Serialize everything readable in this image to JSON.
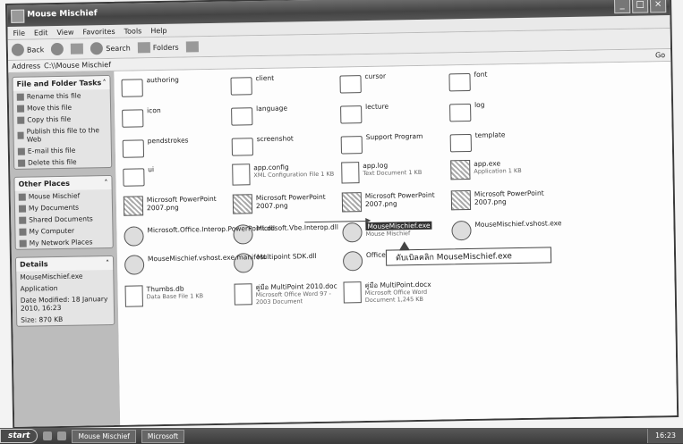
{
  "window": {
    "title": "Mouse Mischief"
  },
  "menu": [
    "File",
    "Edit",
    "View",
    "Favorites",
    "Tools",
    "Help"
  ],
  "toolbar": {
    "back": "Back",
    "search": "Search",
    "folders": "Folders"
  },
  "address": {
    "label": "Address",
    "path": "C:\\\\Mouse Mischief",
    "go": "Go"
  },
  "taskpane": {
    "file_tasks": {
      "title": "File and Folder Tasks",
      "items": [
        "Rename this file",
        "Move this file",
        "Copy this file",
        "Publish this file to the Web",
        "E-mail this file",
        "Delete this file"
      ]
    },
    "other_places": {
      "title": "Other Places",
      "items": [
        "Mouse Mischief",
        "My Documents",
        "Shared Documents",
        "My Computer",
        "My Network Places"
      ]
    },
    "details": {
      "title": "Details",
      "lines": [
        "MouseMischief.exe",
        "Application",
        "Date Modified: 18 January 2010, 16:23",
        "Size: 870 KB"
      ]
    }
  },
  "files": [
    {
      "name": "authoring",
      "sub": "",
      "type": "folder"
    },
    {
      "name": "client",
      "sub": "",
      "type": "folder"
    },
    {
      "name": "cursor",
      "sub": "",
      "type": "folder"
    },
    {
      "name": "font",
      "sub": "",
      "type": "folder"
    },
    {
      "name": "icon",
      "sub": "",
      "type": "folder"
    },
    {
      "name": "language",
      "sub": "",
      "type": "folder"
    },
    {
      "name": "lecture",
      "sub": "",
      "type": "folder"
    },
    {
      "name": "log",
      "sub": "",
      "type": "folder"
    },
    {
      "name": "pendstrokes",
      "sub": "",
      "type": "folder"
    },
    {
      "name": "screenshot",
      "sub": "",
      "type": "folder"
    },
    {
      "name": "Support Program",
      "sub": "",
      "type": "folder"
    },
    {
      "name": "template",
      "sub": "",
      "type": "folder"
    },
    {
      "name": "ui",
      "sub": "",
      "type": "folder"
    },
    {
      "name": "app.config",
      "sub": "XML Configuration File 1 KB",
      "type": "doc"
    },
    {
      "name": "app.log",
      "sub": "Text Document 1 KB",
      "type": "doc"
    },
    {
      "name": "app.exe",
      "sub": "Application 1 KB",
      "type": "img"
    },
    {
      "name": "Microsoft PowerPoint 2007.png",
      "sub": "",
      "type": "img"
    },
    {
      "name": "Microsoft PowerPoint 2007.png",
      "sub": "",
      "type": "img"
    },
    {
      "name": "Microsoft PowerPoint 2007.png",
      "sub": "",
      "type": "img"
    },
    {
      "name": "Microsoft PowerPoint 2007.png",
      "sub": "",
      "type": "img"
    },
    {
      "name": "Microsoft.Office.Interop.PowerPoint.dll",
      "sub": "",
      "type": "app"
    },
    {
      "name": "Microsoft.Vbe.Interop.dll",
      "sub": "",
      "type": "app"
    },
    {
      "name": "MouseMischief.exe",
      "sub": "Mouse Mischief",
      "type": "app",
      "selected": true
    },
    {
      "name": "MouseMischief.vshost.exe",
      "sub": "",
      "type": "app"
    },
    {
      "name": "MouseMischief.vshost.exe.manifest",
      "sub": "",
      "type": "app"
    },
    {
      "name": "Multipoint SDK.dll",
      "sub": "",
      "type": "app"
    },
    {
      "name": "Office.dll",
      "sub": "",
      "type": "app"
    },
    {
      "name": "",
      "sub": "",
      "type": "none"
    },
    {
      "name": "Thumbs.db",
      "sub": "Data Base File 1 KB",
      "type": "doc"
    },
    {
      "name": "คู่มือ MultiPoint 2010.doc",
      "sub": "Microsoft Office Word 97 - 2003 Document",
      "type": "doc"
    },
    {
      "name": "คู่มือ MultiPoint.docx",
      "sub": "Microsoft Office Word Document 1,245 KB",
      "type": "doc"
    }
  ],
  "callout": {
    "text": "ดับเบิลคลิก MouseMischief.exe"
  },
  "taskbar": {
    "start": "start",
    "buttons": [
      "Mouse Mischief",
      "Microsoft"
    ],
    "clock": "16:23"
  }
}
